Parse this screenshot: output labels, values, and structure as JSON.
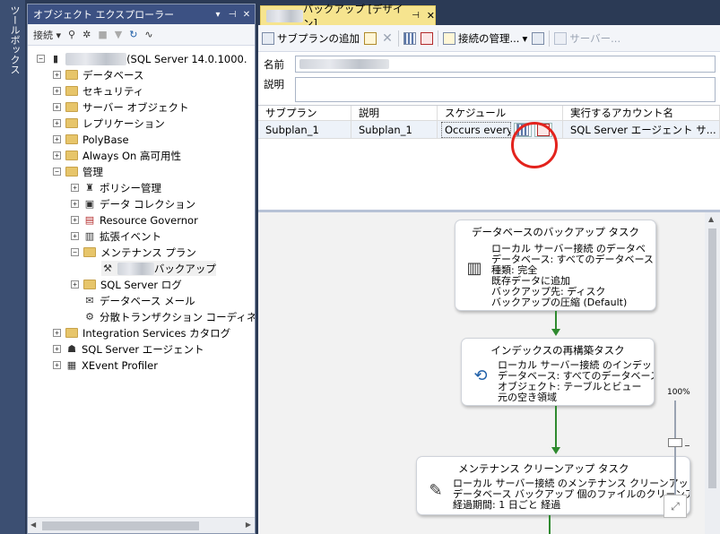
{
  "toolbox": {
    "label": "ツールボックス"
  },
  "object_explorer": {
    "title": "オブジェクト エクスプローラー",
    "toolbar": {
      "connect_label": "接続 ▾"
    },
    "server_node": {
      "name_blurred": "xxxxxxxxxx",
      "suffix": "(SQL Server 14.0.1000."
    },
    "items": {
      "databases": "データベース",
      "security": "セキュリティ",
      "server_objects": "サーバー オブジェクト",
      "replication": "レプリケーション",
      "polybase": "PolyBase",
      "always_on": "Always On 高可用性",
      "management": "管理",
      "policy": "ポリシー管理",
      "data_collection": "データ コレクション",
      "resource_governor": "Resource Governor",
      "extended_events": "拡張イベント",
      "maintenance_plans": "メンテナンス プラン",
      "plan_blurred": "xxxxxx",
      "plan_suffix": "バックアップ",
      "sql_server_log": "SQL Server ログ",
      "database_mail": "データベース メール",
      "dtc": "分散トランザクション コーディネーター",
      "integration_services": "Integration Services カタログ",
      "sql_agent": "SQL Server エージェント",
      "xevent_profiler": "XEvent Profiler"
    }
  },
  "designer": {
    "tab": {
      "blurred": "xxxxxx",
      "label": "バックアップ [デザイン]",
      "pin": "⊣",
      "close": "✕"
    },
    "toolbar": {
      "add_subplan": "サブプランの追加",
      "manage_connections": "接続の管理...",
      "servers": "サーバー..."
    },
    "name_label": "名前",
    "description_label": "説明",
    "grid": {
      "headers": [
        "サブプラン",
        "説明",
        "スケジュール",
        "実行するアカウント名"
      ],
      "row": {
        "subplan": "Subplan_1",
        "description": "Subplan_1",
        "schedule": "Occurs every...",
        "account": "SQL Server エージェント サ..."
      }
    },
    "tasks": [
      {
        "title": "データベースのバックアップ タスク",
        "icon": "backup-icon",
        "lines": [
          "ローカル サーバー接続 のデータベ",
          "データベース: すべてのデータベース",
          "種類: 完全",
          "既存データに追加",
          "バックアップ先: ディスク",
          "バックアップの圧縮 (Default)"
        ]
      },
      {
        "title": "インデックスの再構築タスク",
        "icon": "rebuild-index-icon",
        "lines": [
          "ローカル サーバー接続 のインデッ",
          "データベース: すべてのデータベース",
          "オブジェクト: テーブルとビュー",
          "元の空き領域"
        ]
      },
      {
        "title": "メンテナンス クリーンアップ タスク",
        "icon": "cleanup-icon",
        "lines": [
          "ローカル サーバー接続 のメンテナンス クリーンアップ",
          "データベース バックアップ 個のファイルのクリーンアップ",
          "経過期間: 1 日ごと 経過"
        ]
      }
    ],
    "zoom": {
      "percent_label": "100%"
    }
  }
}
